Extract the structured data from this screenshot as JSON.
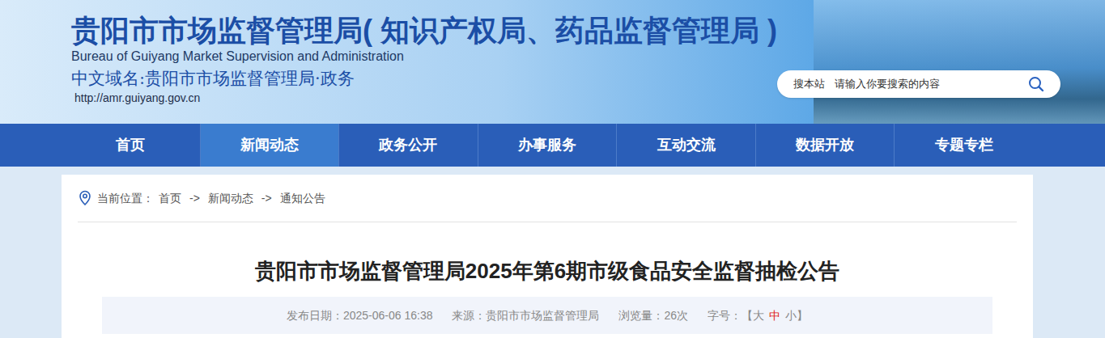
{
  "header": {
    "title": "贵阳市市场监督管理局( 知识产权局、药品监督管理局 )",
    "subtitle": "Bureau of Guiyang Market Supervision and Administration",
    "domain": "中文域名:贵阳市市场监督管理局·政务",
    "url": "http://amr.guiyang.gov.cn"
  },
  "search": {
    "scope": "搜本站",
    "placeholder": "请输入你要搜索的内容"
  },
  "nav": [
    {
      "label": "首页",
      "selected": false
    },
    {
      "label": "新闻动态",
      "selected": true
    },
    {
      "label": "政务公开",
      "selected": false
    },
    {
      "label": "办事服务",
      "selected": false
    },
    {
      "label": "互动交流",
      "selected": false
    },
    {
      "label": "数据开放",
      "selected": false
    },
    {
      "label": "专题专栏",
      "selected": false
    }
  ],
  "breadcrumb": {
    "label": "当前位置：",
    "separator": "->",
    "items": [
      "首页",
      "新闻动态",
      "通知公告"
    ]
  },
  "article": {
    "title": "贵阳市市场监督管理局2025年第6期市级食品安全监督抽检公告"
  },
  "meta": {
    "date": "发布日期：2025-06-06 16:38",
    "source": "来源：贵阳市市场监督管理局",
    "views": "浏览量：26次",
    "font_size": {
      "label": "字号：",
      "open": "【",
      "close": "】",
      "options": [
        {
          "label": "大",
          "selected": false
        },
        {
          "label": "中",
          "selected": true
        },
        {
          "label": "小",
          "selected": false
        }
      ]
    }
  }
}
